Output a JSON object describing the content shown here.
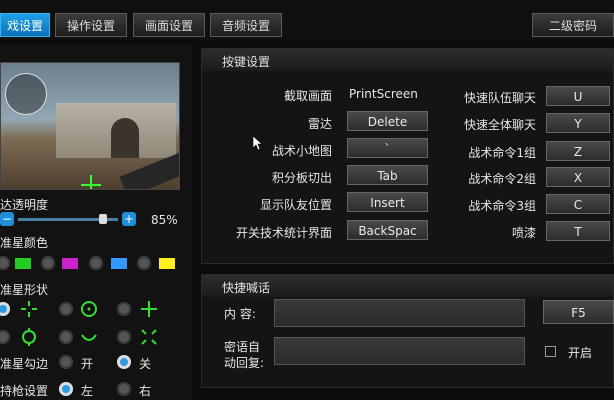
{
  "tabs": [
    {
      "label": "戏设置",
      "active": true
    },
    {
      "label": "操作设置",
      "active": false
    },
    {
      "label": "画面设置",
      "active": false
    },
    {
      "label": "音频设置",
      "active": false
    }
  ],
  "secondary_password_label": "二级密码",
  "left": {
    "radar_opacity_label": "达透明度",
    "radar_opacity_value": "85%",
    "radar_opacity_fraction": 0.85,
    "minus": "−",
    "plus": "+",
    "crosshair_color_label": "准星颜色",
    "colors": [
      "#22cc22",
      "#cc22cc",
      "#3399ff",
      "#ffee22"
    ],
    "crosshair_shape_label": "准星形状",
    "crosshair_outline_label": "准星勾边",
    "outline_on": "开",
    "outline_off": "关",
    "holder_label": "持枪设置",
    "holder_left": "左",
    "holder_right": "右"
  },
  "keys": {
    "title": "按键设置",
    "rows": [
      {
        "label": "截取画面",
        "value": "PrintScreen",
        "label2": "快速队伍聊天",
        "value2": "U"
      },
      {
        "label": "雷达",
        "value": "Delete",
        "label2": "快速全体聊天",
        "value2": "Y"
      },
      {
        "label": "战术小地图",
        "value": "`",
        "label2": "战术命令1组",
        "value2": "Z"
      },
      {
        "label": "积分板切出",
        "value": "Tab",
        "label2": "战术命令2组",
        "value2": "X"
      },
      {
        "label": "显示队友位置",
        "value": "Insert",
        "label2": "战术命令3组",
        "value2": "C"
      },
      {
        "label": "开关技术统计界面",
        "value": "BackSpac",
        "label2": "喷漆",
        "value2": "T"
      }
    ]
  },
  "quick": {
    "title": "快捷喊话",
    "content_label": "内    容:",
    "content_value": "",
    "key": "F5",
    "reply_label_1": "密语自",
    "reply_label_2": "动回复:",
    "reply_value": "",
    "enable_label": "开启"
  }
}
